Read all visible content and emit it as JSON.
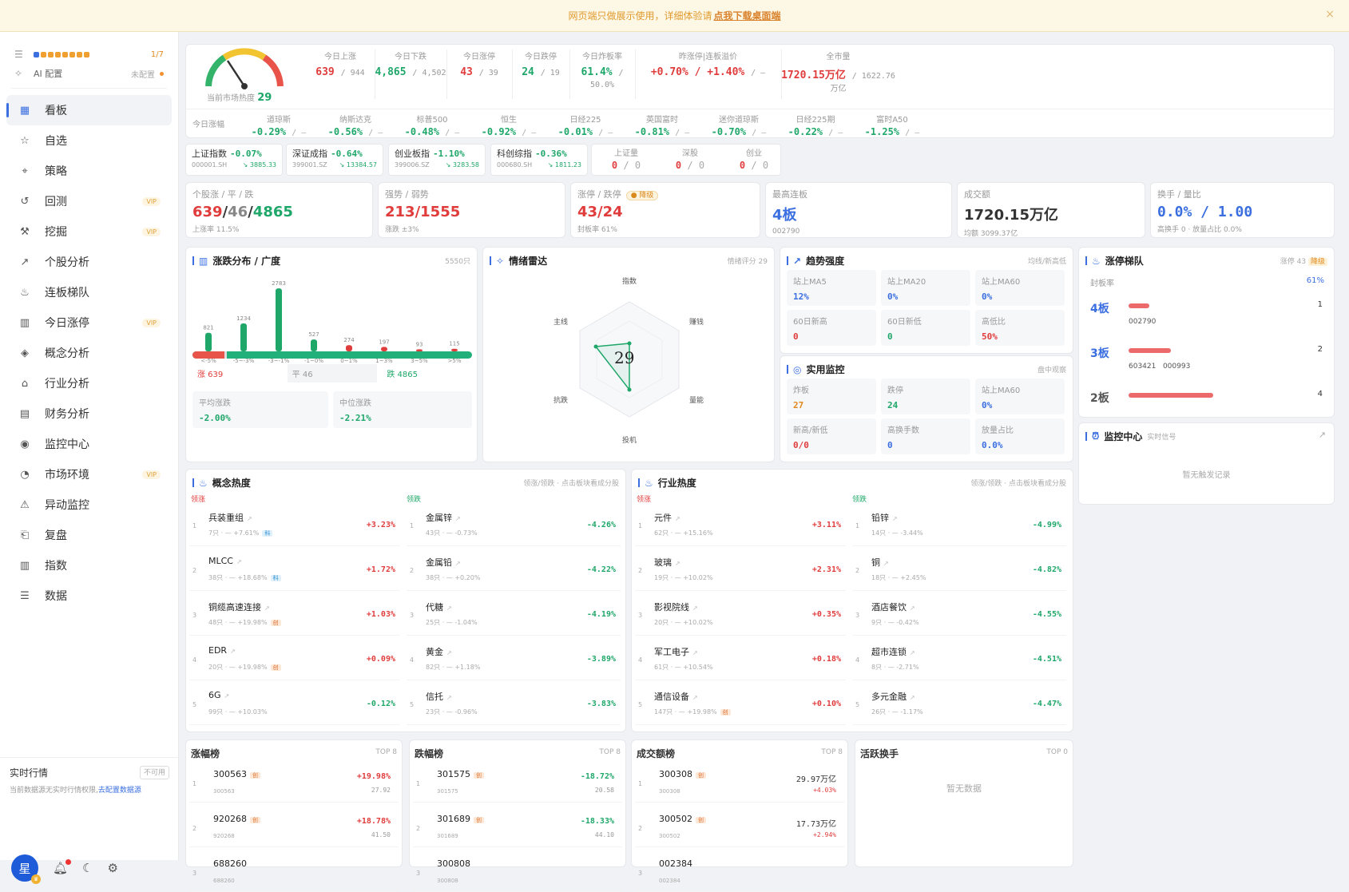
{
  "banner": {
    "text": "网页端只做展示使用，详细体验请",
    "link": "点我下载桌面端",
    "close": "×"
  },
  "sidebar": {
    "top": {
      "progress": "1/7",
      "ai_label": "AI 配置",
      "ai_status": "未配置"
    },
    "items": [
      {
        "label": "看板",
        "icon": "▦",
        "vip": ""
      },
      {
        "label": "自选",
        "icon": "☆",
        "vip": ""
      },
      {
        "label": "策略",
        "icon": "⌖",
        "vip": ""
      },
      {
        "label": "回测",
        "icon": "↺",
        "vip": "VIP"
      },
      {
        "label": "挖掘",
        "icon": "⚒",
        "vip": "VIP"
      },
      {
        "label": "个股分析",
        "icon": "↗",
        "vip": ""
      },
      {
        "label": "连板梯队",
        "icon": "♨",
        "vip": ""
      },
      {
        "label": "今日涨停",
        "icon": "▥",
        "vip": "VIP"
      },
      {
        "label": "概念分析",
        "icon": "◈",
        "vip": ""
      },
      {
        "label": "行业分析",
        "icon": "⌂",
        "vip": ""
      },
      {
        "label": "财务分析",
        "icon": "▤",
        "vip": ""
      },
      {
        "label": "监控中心",
        "icon": "◉",
        "vip": ""
      },
      {
        "label": "市场环境",
        "icon": "◔",
        "vip": "VIP"
      },
      {
        "label": "异动监控",
        "icon": "⚠",
        "vip": ""
      },
      {
        "label": "复盘",
        "icon": "⎗",
        "vip": ""
      },
      {
        "label": "指数",
        "icon": "▥",
        "vip": ""
      },
      {
        "label": "数据",
        "icon": "☰",
        "vip": ""
      }
    ],
    "realtime": {
      "label": "实时行情",
      "status": "不可用",
      "sub": "当前数据源无实时行情权限,",
      "link": "去配置数据源"
    },
    "avatar": "星"
  },
  "gauge": {
    "label": "当前市场热度",
    "value": "29",
    "ticks": [
      "0",
      "20",
      "40",
      "50",
      "60",
      "80",
      "100"
    ]
  },
  "stats": [
    {
      "l": "今日上涨",
      "v": "639",
      "s": "/ 944",
      "c": "red"
    },
    {
      "l": "今日下跌",
      "v": "4,865",
      "s": "/ 4,502",
      "c": "green"
    },
    {
      "l": "今日涨停",
      "v": "43",
      "s": "/ 39",
      "c": "red"
    },
    {
      "l": "今日跌停",
      "v": "24",
      "s": "/ 19",
      "c": "green"
    },
    {
      "l": "今日炸板率",
      "v": "61.4%",
      "s": "/ 50.0%",
      "c": "green"
    },
    {
      "l": "昨涨停|连板溢价",
      "v": "+0.70% / +1.40%",
      "s": "/ —",
      "c": "red"
    },
    {
      "l": "全市量",
      "v": "1720.15万亿",
      "s": "/ 1622.76万亿",
      "c": "red"
    }
  ],
  "global_label": "今日涨幅",
  "indices": [
    {
      "l": "道琼斯",
      "v": "-0.29%"
    },
    {
      "l": "纳斯达克",
      "v": "-0.56%"
    },
    {
      "l": "标普500",
      "v": "-0.48%"
    },
    {
      "l": "恒生",
      "v": "-0.92%"
    },
    {
      "l": "日经225",
      "v": "-0.01%"
    },
    {
      "l": "英国富时",
      "v": "-0.81%"
    },
    {
      "l": "迷你道琼斯",
      "v": "-0.70%"
    },
    {
      "l": "日经225期",
      "v": "-0.22%"
    },
    {
      "l": "富时A50",
      "v": "-1.25%"
    }
  ],
  "quotes": [
    {
      "n": "上证指数",
      "p": "-0.07%",
      "code": "000001.SH",
      "px": "↘ 3885.33"
    },
    {
      "n": "深证成指",
      "p": "-0.64%",
      "code": "399001.SZ",
      "px": "↘ 13384.57"
    },
    {
      "n": "创业板指",
      "p": "-1.10%",
      "code": "399006.SZ",
      "px": "↘ 3283.58"
    },
    {
      "n": "科创综指",
      "p": "-0.36%",
      "code": "000680.SH",
      "px": "↘ 1811.23"
    }
  ],
  "qsmall": [
    {
      "l": "上证量",
      "v": "0",
      "s": "/ 0"
    },
    {
      "l": "深股",
      "v": "0",
      "s": "/ 0"
    },
    {
      "l": "创业",
      "v": "0",
      "s": "/ 0"
    }
  ],
  "summary": [
    {
      "l": "个股涨 / 平 / 跌",
      "v1": "639",
      "v2": "46",
      "v3": "4865",
      "s": "上涨率 11.5%"
    },
    {
      "l": "强势 / 弱势",
      "v": "213/1555",
      "s": "涨跌 ±3%"
    },
    {
      "l": "涨停 / 跌停",
      "badge": "● 降级",
      "v": "43/24",
      "s": "封板率 61%"
    },
    {
      "l": "最高连板",
      "v": "4板",
      "s": "002790"
    },
    {
      "l": "成交额",
      "v": "1720.15万亿",
      "s": "均额 3099.37亿"
    },
    {
      "l": "换手 / 量比",
      "v": "0.0% / 1.00",
      "s": "高换手 0 · 放量占比 0.0%"
    }
  ],
  "distribution": {
    "title": "涨跌分布 / 广度",
    "right": "5550只",
    "chart_data": {
      "type": "bar",
      "categories": [
        "<-5%",
        "-5~-3%",
        "-3~-1%",
        "-1~0%",
        "0~1%",
        "1~3%",
        "3~5%",
        ">5%"
      ],
      "values": [
        821,
        1234,
        2783,
        527,
        274,
        197,
        93,
        115
      ],
      "colors": [
        "#1fa76a",
        "#1fa76a",
        "#1fa76a",
        "#1fa76a",
        "#e03c3c",
        "#e03c3c",
        "#e03c3c",
        "#e03c3c"
      ]
    },
    "bar": {
      "up_ratio": 0.115,
      "flat_ratio": 0.008
    },
    "zhang": "涨 639",
    "ping": "平 46",
    "die": "跌 4865",
    "avg": {
      "l": "平均涨跌",
      "v": "-2.00%"
    },
    "median": {
      "l": "中位涨跌",
      "v": "-2.21%"
    }
  },
  "radar": {
    "title": "情绪雷达",
    "right": "情绪评分 29",
    "score": "29",
    "axes": [
      "指数",
      "赚钱",
      "量能",
      "投机",
      "抗跌",
      "主线"
    ]
  },
  "trend": {
    "title": "趋势强度",
    "right": "均线/新高低",
    "cells": [
      {
        "l": "站上MA5",
        "v": "12%",
        "c": "blue"
      },
      {
        "l": "站上MA20",
        "v": "0%",
        "c": "blue"
      },
      {
        "l": "站上MA60",
        "v": "0%",
        "c": "blue"
      },
      {
        "l": "60日新高",
        "v": "0",
        "c": "red"
      },
      {
        "l": "60日新低",
        "v": "0",
        "c": "green"
      },
      {
        "l": "高低比",
        "v": "50%",
        "c": "red"
      }
    ]
  },
  "monitor": {
    "title": "实用监控",
    "right": "盘中观察",
    "cells": [
      {
        "l": "炸板",
        "v": "27",
        "c": "orange"
      },
      {
        "l": "跌停",
        "v": "24",
        "c": "green"
      },
      {
        "l": "站上MA60",
        "v": "0%",
        "c": "blue"
      },
      {
        "l": "新高/新低",
        "v": "0/0",
        "c": "red"
      },
      {
        "l": "高换手数",
        "v": "0",
        "c": "blue"
      },
      {
        "l": "放量占比",
        "v": "0.0%",
        "c": "blue"
      }
    ]
  },
  "ladder": {
    "title": "涨停梯队",
    "right": "涨停 43",
    "badge": "降级",
    "seal_label": "封板率",
    "seal": "61%",
    "rows": [
      {
        "b": "4板",
        "codes": "002790",
        "n": "1",
        "w": 0.12
      },
      {
        "b": "3板",
        "codes": "603421   000993",
        "n": "2",
        "w": 0.24
      },
      {
        "b": "2板",
        "codes": "",
        "n": "4",
        "w": 0.48
      }
    ]
  },
  "monitor_center": {
    "title": "监控中心",
    "sub": "实时信号",
    "empty": "暂无触发记录"
  },
  "concept": {
    "title": "概念热度",
    "right": "领涨/领跌 · 点击板块看成分股",
    "lead": "领涨",
    "lag": "领跌",
    "up": [
      {
        "n": "兵装重组",
        "s": "7只 · — +7.61%",
        "t": "科",
        "tc": "b",
        "p": "+3.23%"
      },
      {
        "n": "MLCC",
        "s": "38只 · — +18.68%",
        "t": "科",
        "tc": "b",
        "p": "+1.72%"
      },
      {
        "n": "铜缆高速连接",
        "s": "48只 · — +19.98%",
        "t": "创",
        "tc": "r",
        "p": "+1.03%"
      },
      {
        "n": "EDR",
        "s": "20只 · — +19.98%",
        "t": "创",
        "tc": "r",
        "p": "+0.09%"
      },
      {
        "n": "6G",
        "s": "99只 · — +10.03%",
        "t": "",
        "tc": "",
        "p": "-0.12%"
      }
    ],
    "down": [
      {
        "n": "金属锌",
        "s": "43只 · — -0.73%",
        "p": "-4.26%"
      },
      {
        "n": "金属铅",
        "s": "38只 · — +0.20%",
        "p": "-4.22%"
      },
      {
        "n": "代糖",
        "s": "25只 · — -1.04%",
        "p": "-4.19%"
      },
      {
        "n": "黄金",
        "s": "82只 · — +1.18%",
        "p": "-3.89%"
      },
      {
        "n": "信托",
        "s": "23只 · — -0.96%",
        "p": "-3.83%"
      }
    ]
  },
  "industry": {
    "title": "行业热度",
    "right": "领涨/领跌 · 点击板块看成分股",
    "lead": "领涨",
    "lag": "领跌",
    "up": [
      {
        "n": "元件",
        "s": "62只 · — +15.16%",
        "t": "",
        "tc": "",
        "p": "+3.11%"
      },
      {
        "n": "玻璃",
        "s": "19只 · — +10.02%",
        "t": "",
        "tc": "",
        "p": "+2.31%"
      },
      {
        "n": "影视院线",
        "s": "20只 · — +10.02%",
        "t": "",
        "tc": "",
        "p": "+0.35%"
      },
      {
        "n": "军工电子",
        "s": "61只 · — +10.54%",
        "t": "",
        "tc": "",
        "p": "+0.18%"
      },
      {
        "n": "通信设备",
        "s": "147只 · — +19.98%",
        "t": "创",
        "tc": "r",
        "p": "+0.10%"
      }
    ],
    "down": [
      {
        "n": "铅锌",
        "s": "14只 · — -3.44%",
        "p": "-4.99%"
      },
      {
        "n": "铜",
        "s": "18只 · — +2.45%",
        "p": "-4.82%"
      },
      {
        "n": "酒店餐饮",
        "s": "9只 · — -0.42%",
        "p": "-4.55%"
      },
      {
        "n": "超市连锁",
        "s": "8只 · — -2.71%",
        "p": "-4.51%"
      },
      {
        "n": "多元金融",
        "s": "26只 · — -1.17%",
        "p": "-4.47%"
      }
    ]
  },
  "ranks": [
    {
      "title": "涨幅榜",
      "top": "TOP 8",
      "rows": [
        {
          "code": "300563",
          "p": "+19.98%",
          "x": "27.92",
          "c": "red"
        },
        {
          "code": "920268",
          "p": "+18.78%",
          "x": "41.50",
          "c": "red"
        },
        {
          "code": "688260",
          "p": "",
          "x": "",
          "c": "red"
        }
      ]
    },
    {
      "title": "跌幅榜",
      "top": "TOP 8",
      "rows": [
        {
          "code": "301575",
          "p": "-18.72%",
          "x": "20.58",
          "c": "green"
        },
        {
          "code": "301689",
          "p": "-18.33%",
          "x": "44.10",
          "c": "green"
        },
        {
          "code": "300808",
          "p": "",
          "x": "",
          "c": "green"
        }
      ]
    },
    {
      "title": "成交额榜",
      "top": "TOP 8",
      "rows": [
        {
          "code": "300308",
          "p": "29.97万亿",
          "x": "+4.03%",
          "c": "dark"
        },
        {
          "code": "300502",
          "p": "17.73万亿",
          "x": "+2.94%",
          "c": "dark"
        },
        {
          "code": "002384",
          "p": "",
          "x": "",
          "c": "dark"
        }
      ]
    },
    {
      "title": "活跃换手",
      "top": "TOP 0",
      "empty": "暂无数据",
      "rows": []
    }
  ]
}
